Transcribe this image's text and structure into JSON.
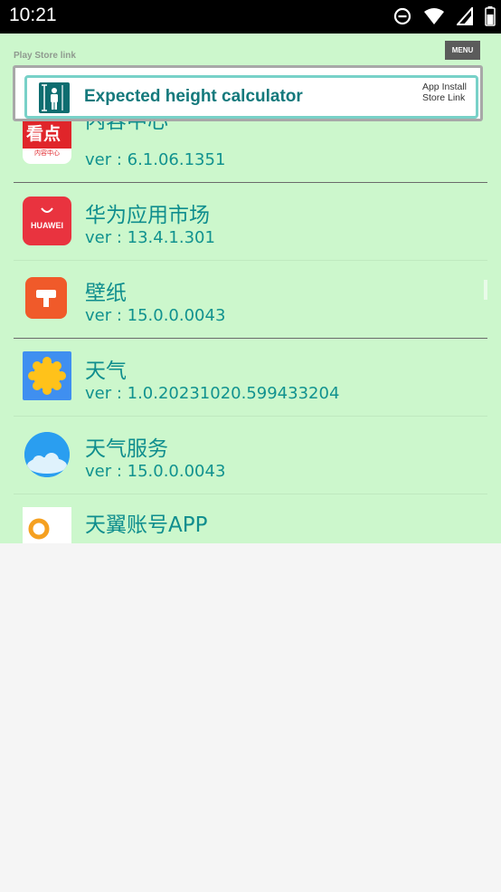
{
  "status_bar": {
    "time": "10:21",
    "icons": [
      "do-not-disturb-icon",
      "wifi-icon",
      "signal-icon",
      "battery-icon"
    ]
  },
  "app": {
    "play_store_label": "Play Store link",
    "menu_label": "MENU",
    "background_color": "#ccf7cc",
    "text_color": "#0f8e8e"
  },
  "ad": {
    "title": "Expected height calculator",
    "store_link_line1": "App Install",
    "store_link_line2": "Store Link"
  },
  "apps": [
    {
      "name": "内容中心",
      "version": "ver : 6.1.06.1351",
      "icon_text": "看点",
      "icon_subtext": "内容中心",
      "icon": "kandian-icon"
    },
    {
      "name": "华为应用市场",
      "version": "ver : 13.4.1.301",
      "icon_text": "HUAWEI",
      "icon": "huawei-appgallery-icon"
    },
    {
      "name": "壁纸",
      "version": "ver : 15.0.0.0043",
      "icon": "wallpaper-brush-icon"
    },
    {
      "name": "天气",
      "version": "ver : 1.0.20231020.599433204",
      "icon": "weather-sun-icon"
    },
    {
      "name": "天气服务",
      "version": "ver : 15.0.0.0043",
      "icon": "weather-cloud-icon"
    },
    {
      "name": "天翼账号APP",
      "version": "",
      "icon": "tianyi-account-icon"
    }
  ]
}
